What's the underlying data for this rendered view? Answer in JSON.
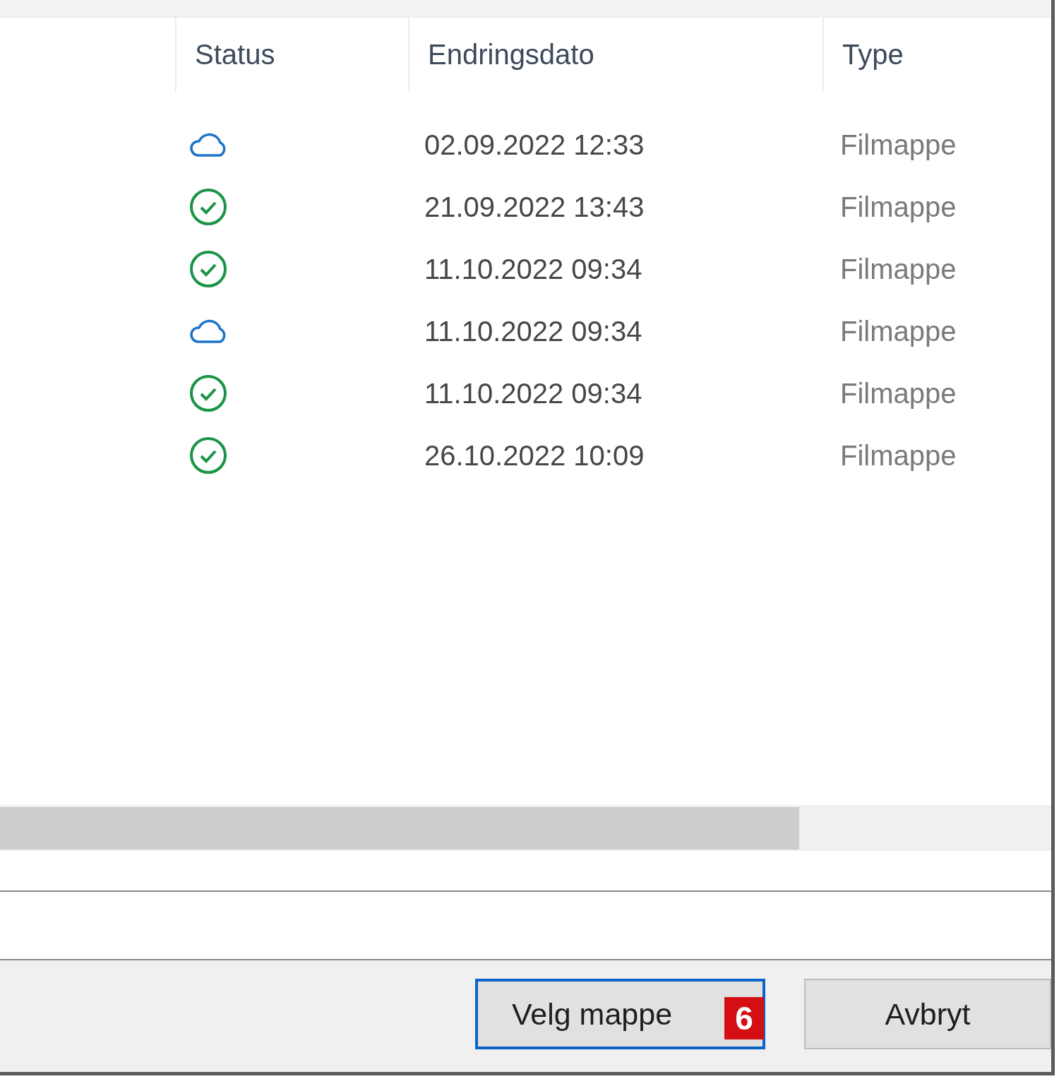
{
  "columns": [
    {
      "label": "Status"
    },
    {
      "label": "Endringsdato"
    },
    {
      "label": "Type"
    }
  ],
  "rows": [
    {
      "status": {
        "kind": "cloud"
      },
      "date": "02.09.2022 12:33",
      "type": "Filmappe"
    },
    {
      "status": {
        "kind": "synced"
      },
      "date": "21.09.2022 13:43",
      "type": "Filmappe"
    },
    {
      "status": {
        "kind": "synced"
      },
      "date": "11.10.2022 09:34",
      "type": "Filmappe"
    },
    {
      "status": {
        "kind": "cloud"
      },
      "date": "11.10.2022 09:34",
      "type": "Filmappe"
    },
    {
      "status": {
        "kind": "synced"
      },
      "date": "11.10.2022 09:34",
      "type": "Filmappe"
    },
    {
      "status": {
        "kind": "synced"
      },
      "date": "26.10.2022 10:09",
      "type": "Filmappe"
    }
  ],
  "buttons": [
    {
      "label": "Velg mappe",
      "primary": true,
      "badge": "6"
    },
    {
      "label": "Avbryt",
      "primary": false
    }
  ]
}
